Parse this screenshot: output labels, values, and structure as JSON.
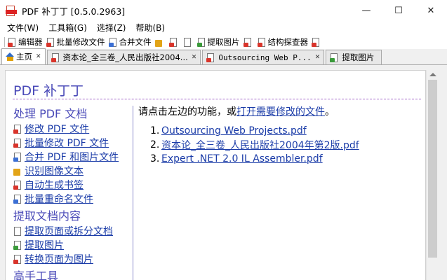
{
  "window": {
    "title": "PDF 补丁丁 [0.5.0.2963]",
    "minimize": "—",
    "maximize": "☐",
    "close": "✕"
  },
  "menu": [
    "文件(W)",
    "工具箱(G)",
    "选择(Z)",
    "帮助(B)"
  ],
  "toolbar": [
    {
      "label": "编辑器",
      "icon": "pdf-edit-icon"
    },
    {
      "label": "批量修改文件",
      "icon": "batch-modify-icon"
    },
    {
      "label": "合并文件",
      "icon": "merge-icon"
    },
    {
      "label": "",
      "icon": "ocr-icon"
    },
    {
      "label": "",
      "icon": "bookmark-icon"
    },
    {
      "label": "",
      "icon": "page-icon"
    },
    {
      "label": "提取图片",
      "icon": "extract-image-icon"
    },
    {
      "label": "",
      "icon": "doc-icon"
    },
    {
      "label": "结构探查器",
      "icon": "structure-icon"
    },
    {
      "label": "",
      "icon": "extra-icon"
    }
  ],
  "tabs": [
    {
      "label": "主页",
      "active": true
    },
    {
      "label": "资本论_全三卷_人民出版社2004...",
      "active": false
    },
    {
      "label": "Outsourcing Web P...",
      "active": false
    },
    {
      "label": "提取图片",
      "active": false
    }
  ],
  "tab_close": "✕",
  "home": {
    "title": "PDF 补丁丁",
    "sections": [
      {
        "heading": "处理 PDF 文档",
        "links": [
          "修改 PDF 文件",
          "批量修改 PDF 文件",
          "合并 PDF 和图片文件",
          "识别图像文本",
          "自动生成书签",
          "批量重命名文件"
        ]
      },
      {
        "heading": "提取文档内容",
        "links": [
          "提取页面或拆分文档",
          "提取图片",
          "转换页面为图片"
        ]
      },
      {
        "heading": "高手工具",
        "links": []
      }
    ],
    "instruction_prefix": "请点击左边的功能，或",
    "instruction_link": "打开需要修改的文件",
    "instruction_suffix": "。",
    "recent_files": [
      {
        "num": "1.",
        "name": "Outsourcing Web Projects.pdf"
      },
      {
        "num": "2.",
        "name": "资本论_全三卷_人民出版社2004年第2版.pdf"
      },
      {
        "num": "3.",
        "name": "Expert .NET 2.0 IL Assembler.pdf"
      }
    ]
  },
  "colors": {
    "heading": "#4a4ab8",
    "link": "#1b3ca8",
    "rule": "#a266c8"
  }
}
